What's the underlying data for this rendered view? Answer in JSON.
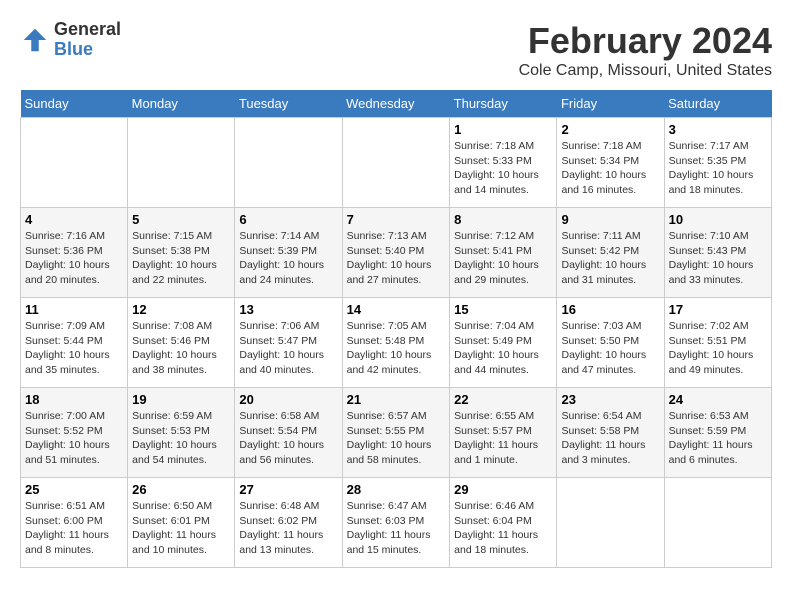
{
  "header": {
    "logo_line1": "General",
    "logo_line2": "Blue",
    "main_title": "February 2024",
    "subtitle": "Cole Camp, Missouri, United States"
  },
  "days_of_week": [
    "Sunday",
    "Monday",
    "Tuesday",
    "Wednesday",
    "Thursday",
    "Friday",
    "Saturday"
  ],
  "weeks": [
    [
      {
        "day": "",
        "info": ""
      },
      {
        "day": "",
        "info": ""
      },
      {
        "day": "",
        "info": ""
      },
      {
        "day": "",
        "info": ""
      },
      {
        "day": "1",
        "info": "Sunrise: 7:18 AM\nSunset: 5:33 PM\nDaylight: 10 hours\nand 14 minutes."
      },
      {
        "day": "2",
        "info": "Sunrise: 7:18 AM\nSunset: 5:34 PM\nDaylight: 10 hours\nand 16 minutes."
      },
      {
        "day": "3",
        "info": "Sunrise: 7:17 AM\nSunset: 5:35 PM\nDaylight: 10 hours\nand 18 minutes."
      }
    ],
    [
      {
        "day": "4",
        "info": "Sunrise: 7:16 AM\nSunset: 5:36 PM\nDaylight: 10 hours\nand 20 minutes."
      },
      {
        "day": "5",
        "info": "Sunrise: 7:15 AM\nSunset: 5:38 PM\nDaylight: 10 hours\nand 22 minutes."
      },
      {
        "day": "6",
        "info": "Sunrise: 7:14 AM\nSunset: 5:39 PM\nDaylight: 10 hours\nand 24 minutes."
      },
      {
        "day": "7",
        "info": "Sunrise: 7:13 AM\nSunset: 5:40 PM\nDaylight: 10 hours\nand 27 minutes."
      },
      {
        "day": "8",
        "info": "Sunrise: 7:12 AM\nSunset: 5:41 PM\nDaylight: 10 hours\nand 29 minutes."
      },
      {
        "day": "9",
        "info": "Sunrise: 7:11 AM\nSunset: 5:42 PM\nDaylight: 10 hours\nand 31 minutes."
      },
      {
        "day": "10",
        "info": "Sunrise: 7:10 AM\nSunset: 5:43 PM\nDaylight: 10 hours\nand 33 minutes."
      }
    ],
    [
      {
        "day": "11",
        "info": "Sunrise: 7:09 AM\nSunset: 5:44 PM\nDaylight: 10 hours\nand 35 minutes."
      },
      {
        "day": "12",
        "info": "Sunrise: 7:08 AM\nSunset: 5:46 PM\nDaylight: 10 hours\nand 38 minutes."
      },
      {
        "day": "13",
        "info": "Sunrise: 7:06 AM\nSunset: 5:47 PM\nDaylight: 10 hours\nand 40 minutes."
      },
      {
        "day": "14",
        "info": "Sunrise: 7:05 AM\nSunset: 5:48 PM\nDaylight: 10 hours\nand 42 minutes."
      },
      {
        "day": "15",
        "info": "Sunrise: 7:04 AM\nSunset: 5:49 PM\nDaylight: 10 hours\nand 44 minutes."
      },
      {
        "day": "16",
        "info": "Sunrise: 7:03 AM\nSunset: 5:50 PM\nDaylight: 10 hours\nand 47 minutes."
      },
      {
        "day": "17",
        "info": "Sunrise: 7:02 AM\nSunset: 5:51 PM\nDaylight: 10 hours\nand 49 minutes."
      }
    ],
    [
      {
        "day": "18",
        "info": "Sunrise: 7:00 AM\nSunset: 5:52 PM\nDaylight: 10 hours\nand 51 minutes."
      },
      {
        "day": "19",
        "info": "Sunrise: 6:59 AM\nSunset: 5:53 PM\nDaylight: 10 hours\nand 54 minutes."
      },
      {
        "day": "20",
        "info": "Sunrise: 6:58 AM\nSunset: 5:54 PM\nDaylight: 10 hours\nand 56 minutes."
      },
      {
        "day": "21",
        "info": "Sunrise: 6:57 AM\nSunset: 5:55 PM\nDaylight: 10 hours\nand 58 minutes."
      },
      {
        "day": "22",
        "info": "Sunrise: 6:55 AM\nSunset: 5:57 PM\nDaylight: 11 hours\nand 1 minute."
      },
      {
        "day": "23",
        "info": "Sunrise: 6:54 AM\nSunset: 5:58 PM\nDaylight: 11 hours\nand 3 minutes."
      },
      {
        "day": "24",
        "info": "Sunrise: 6:53 AM\nSunset: 5:59 PM\nDaylight: 11 hours\nand 6 minutes."
      }
    ],
    [
      {
        "day": "25",
        "info": "Sunrise: 6:51 AM\nSunset: 6:00 PM\nDaylight: 11 hours\nand 8 minutes."
      },
      {
        "day": "26",
        "info": "Sunrise: 6:50 AM\nSunset: 6:01 PM\nDaylight: 11 hours\nand 10 minutes."
      },
      {
        "day": "27",
        "info": "Sunrise: 6:48 AM\nSunset: 6:02 PM\nDaylight: 11 hours\nand 13 minutes."
      },
      {
        "day": "28",
        "info": "Sunrise: 6:47 AM\nSunset: 6:03 PM\nDaylight: 11 hours\nand 15 minutes."
      },
      {
        "day": "29",
        "info": "Sunrise: 6:46 AM\nSunset: 6:04 PM\nDaylight: 11 hours\nand 18 minutes."
      },
      {
        "day": "",
        "info": ""
      },
      {
        "day": "",
        "info": ""
      }
    ]
  ]
}
